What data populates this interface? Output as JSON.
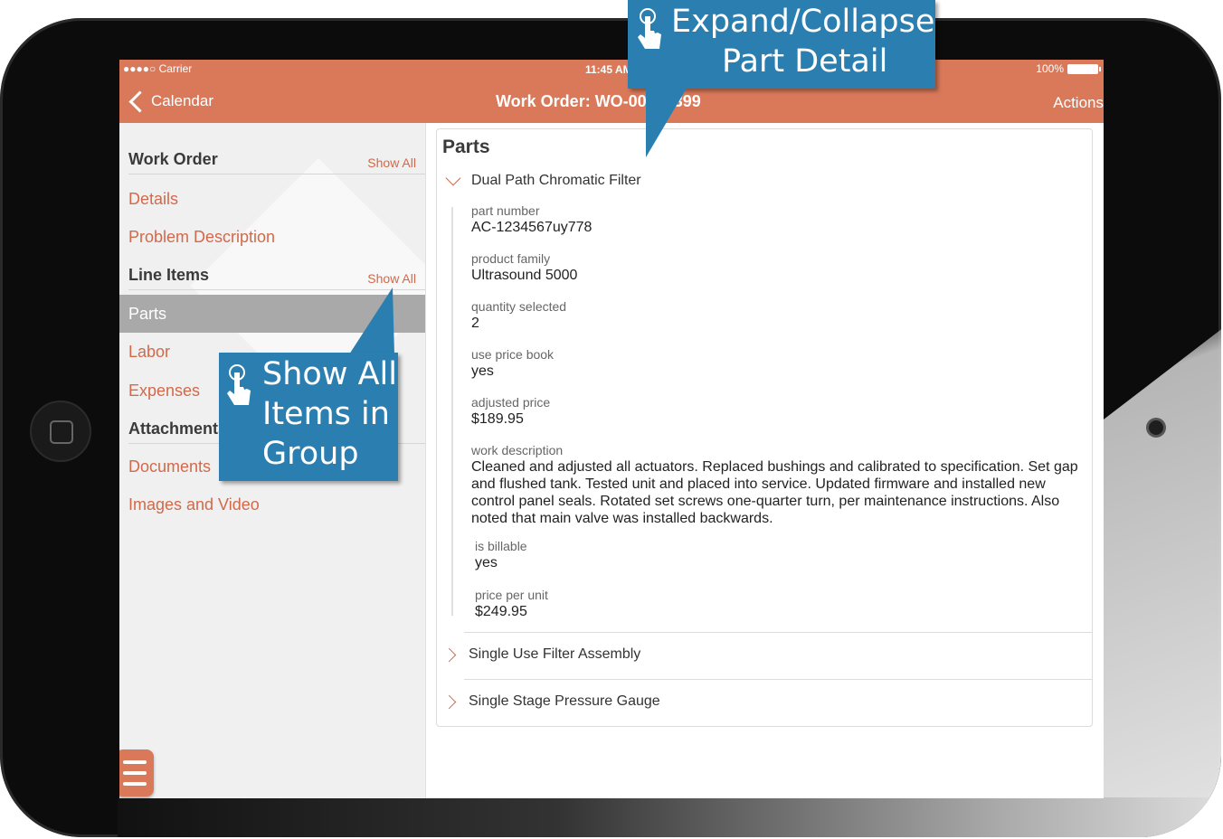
{
  "status_bar": {
    "carrier": "●●●●○ Carrier",
    "time": "11:45 AM",
    "battery": "100%"
  },
  "nav": {
    "back_label": "Calendar",
    "title": "Work Order: WO-00003399",
    "actions_label": "Actions"
  },
  "sidebar": {
    "work_order": {
      "title": "Work Order",
      "show_all": "Show All",
      "items": [
        "Details",
        "Problem Description"
      ]
    },
    "line_items": {
      "title": "Line Items",
      "show_all": "Show All",
      "items": [
        "Parts",
        "Labor",
        "Expenses"
      ]
    },
    "attachments": {
      "title": "Attachments",
      "items": [
        "Documents",
        "Images and Video"
      ]
    }
  },
  "main": {
    "title": "Parts",
    "expanded_part": {
      "name": "Dual Path Chromatic Filter",
      "fields": [
        {
          "label": "part number",
          "value": "AC-1234567uy778"
        },
        {
          "label": "product family",
          "value": "Ultrasound 5000"
        },
        {
          "label": "quantity selected",
          "value": "2"
        },
        {
          "label": "use price book",
          "value": "yes"
        },
        {
          "label": "adjusted price",
          "value": "$189.95"
        },
        {
          "label": "work description",
          "value": "Cleaned and adjusted all actuators. Replaced bushings and calibrated to specification. Set gap and flushed tank. Tested unit and placed into service. Updated firmware and installed new control panel seals. Rotated set screws one-quarter turn, per maintenance instructions. Also noted that main valve was installed backwards."
        },
        {
          "label": "is billable",
          "value": "yes"
        },
        {
          "label": "price per unit",
          "value": "$249.95"
        }
      ]
    },
    "collapsed_parts": [
      "Single Use Filter Assembly",
      "Single Stage Pressure Gauge"
    ]
  },
  "callouts": {
    "expand": {
      "line1": "Expand/Collapse",
      "line2": "Part Detail"
    },
    "show_all": {
      "line1": "Show All",
      "line2": "Items in",
      "line3": "Group"
    }
  },
  "colors": {
    "accent": "#d9795a",
    "link": "#d2694a",
    "callout": "#2b7fb0",
    "selected": "#a9a9a9"
  }
}
